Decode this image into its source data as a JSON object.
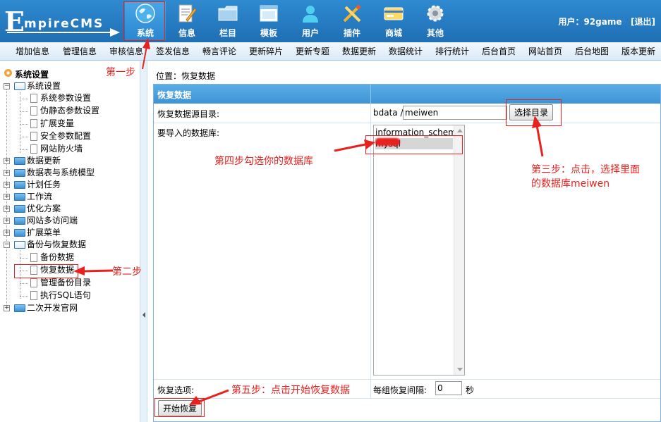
{
  "header": {
    "logo_text": "EmpireCMS",
    "user_label": "用户：92game",
    "logout_label": "[退出]",
    "nav": [
      {
        "label": "系统",
        "icon": "globe-icon"
      },
      {
        "label": "信息",
        "icon": "edit-icon"
      },
      {
        "label": "栏目",
        "icon": "folder-icon"
      },
      {
        "label": "模板",
        "icon": "window-icon"
      },
      {
        "label": "用户",
        "icon": "user-icon"
      },
      {
        "label": "插件",
        "icon": "tools-icon"
      },
      {
        "label": "商城",
        "icon": "card-icon"
      },
      {
        "label": "其他",
        "icon": "gear-icon"
      }
    ]
  },
  "submenu": [
    "增加信息",
    "管理信息",
    "审核信息",
    "签发信息",
    "畅言评论",
    "更新碎片",
    "更新专题",
    "数据更新",
    "数据统计",
    "排行统计",
    "后台首页",
    "网站首页",
    "后台地图",
    "版本更新"
  ],
  "sidebar": {
    "title": "系统设置",
    "items": [
      {
        "label": "系统设置",
        "type": "folder",
        "expanded": true
      },
      {
        "label": "系统参数设置",
        "type": "doc"
      },
      {
        "label": "伪静态参数设置",
        "type": "doc"
      },
      {
        "label": "扩展变量",
        "type": "doc"
      },
      {
        "label": "安全参数配置",
        "type": "doc"
      },
      {
        "label": "网站防火墙",
        "type": "doc"
      },
      {
        "label": "数据更新",
        "type": "folder"
      },
      {
        "label": "数据表与系统模型",
        "type": "folder"
      },
      {
        "label": "计划任务",
        "type": "folder"
      },
      {
        "label": "工作流",
        "type": "folder"
      },
      {
        "label": "优化方案",
        "type": "folder"
      },
      {
        "label": "网站多访问端",
        "type": "folder"
      },
      {
        "label": "扩展菜单",
        "type": "folder"
      },
      {
        "label": "备份与恢复数据",
        "type": "folder",
        "expanded": true
      },
      {
        "label": "备份数据",
        "type": "doc"
      },
      {
        "label": "恢复数据",
        "type": "doc"
      },
      {
        "label": "管理备份目录",
        "type": "doc"
      },
      {
        "label": "执行SQL语句",
        "type": "doc"
      },
      {
        "label": "二次开发官网",
        "type": "folder"
      }
    ]
  },
  "main": {
    "location": "位置：恢复数据",
    "panel_title": "恢复数据",
    "dir_label": "恢复数据源目录:",
    "dir_prefix": "bdata /",
    "dir_value": "meiwen",
    "choose_dir_label": "选择目录",
    "db_label": "要导入的数据库:",
    "databases": [
      {
        "name": "information_schema",
        "selected": false
      },
      {
        "name": "mysql",
        "selected": true
      }
    ],
    "options_label": "恢复选项:",
    "interval_label": "每组恢复间隔:",
    "interval_value": "0",
    "interval_unit": "秒",
    "start_label": "开始恢复"
  },
  "annotations": {
    "step1": "第一步",
    "step2": "第二步",
    "step3_line1": "第三步：点击，选择里面",
    "step3_line2": "的数据库meiwen",
    "step4": "第四步勾选你的数据库",
    "step5": "第五步：点击开始恢复数据",
    "color": "#e8201e"
  },
  "colors": {
    "header_blue": "#1f6fb4",
    "panel_head_blue": "#3d93d4",
    "annotation_red": "#e8201e"
  }
}
